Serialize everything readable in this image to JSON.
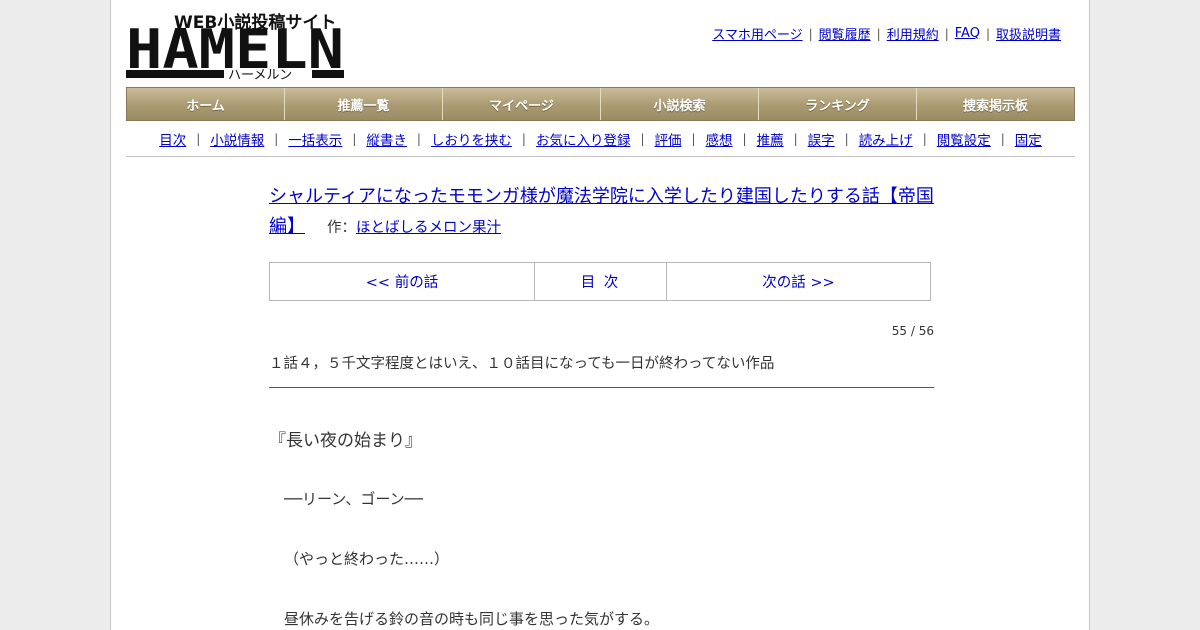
{
  "logo": {
    "tagline": "WEB小説投稿サイト",
    "wordmark": "HAMELN",
    "kana": "ハーメルン"
  },
  "toplinks": [
    "スマホ用ページ",
    "閲覧履歴",
    "利用規約",
    "FAQ",
    "取扱説明書"
  ],
  "mainnav": [
    "ホーム",
    "推薦一覧",
    "マイページ",
    "小説検索",
    "ランキング",
    "捜索掲示板"
  ],
  "subnav": [
    "目次",
    "小説情報",
    "一括表示",
    "縦書き",
    "しおりを挟む",
    "お気に入り登録",
    "評価",
    "感想",
    "推薦",
    "誤字",
    "読み上げ",
    "閲覧設定",
    "固定"
  ],
  "novel": {
    "title": "シャルティアになったモモンガ様が魔法学院に入学したり建国したりする話【帝国編】",
    "author_label": "作：",
    "author": "ほとばしるメロン果汁"
  },
  "chapter_nav": {
    "prev": "<< 前の話",
    "toc": "目 次",
    "next": "次の話 >>"
  },
  "counter": "55 / 56",
  "foreword": "１話４，５千文字程度とはいえ、１０話目になっても一日が終わってない作品",
  "body": {
    "heading": "『長い夜の始まり』",
    "lines": [
      "──リーン、ゴーン──",
      "（やっと終わった……）",
      "昼休みを告げる鈴の音の時も同じ事を思った気がする。"
    ]
  }
}
